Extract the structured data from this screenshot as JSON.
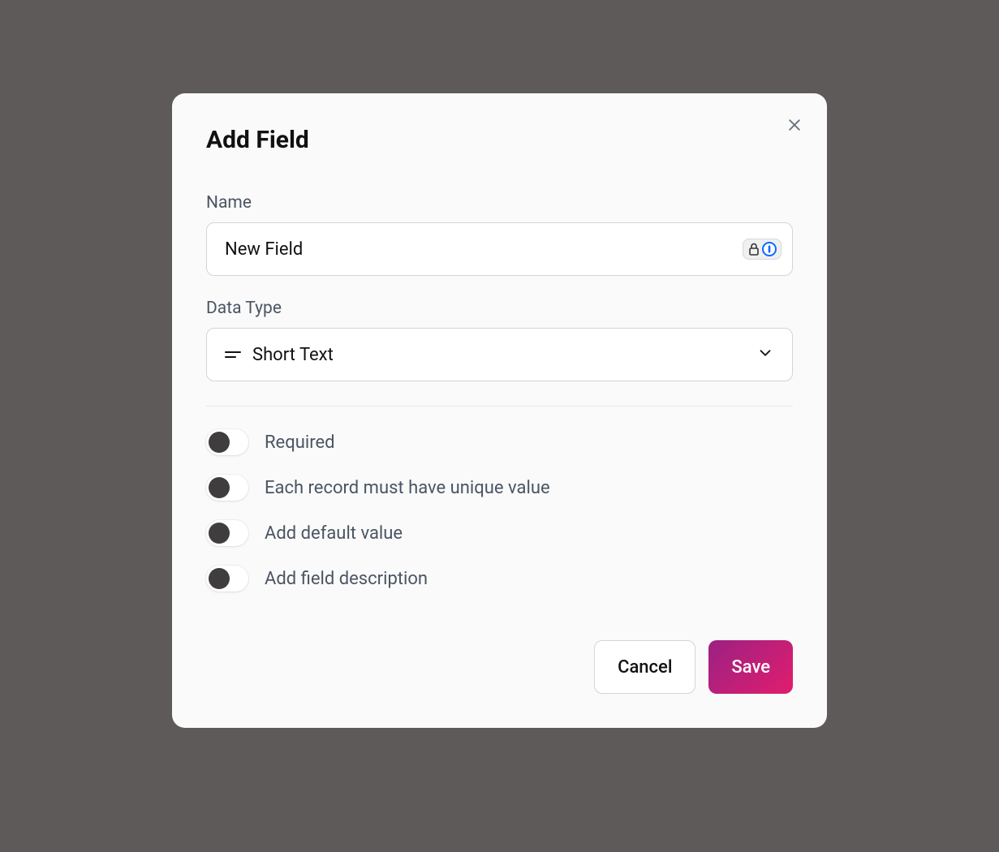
{
  "modal": {
    "title": "Add Field",
    "fields": {
      "name": {
        "label": "Name",
        "value": "New Field"
      },
      "dataType": {
        "label": "Data Type",
        "selected": "Short Text",
        "icon": "short-text-icon"
      }
    },
    "toggles": [
      {
        "label": "Required",
        "on": false
      },
      {
        "label": "Each record must have unique value",
        "on": false
      },
      {
        "label": "Add default value",
        "on": false
      },
      {
        "label": "Add field description",
        "on": false
      }
    ],
    "footer": {
      "cancel": "Cancel",
      "save": "Save"
    },
    "icons": {
      "close": "close-icon",
      "chevron": "chevron-down-icon",
      "passwordManager": "password-manager-icon",
      "lock": "lock-icon"
    }
  }
}
